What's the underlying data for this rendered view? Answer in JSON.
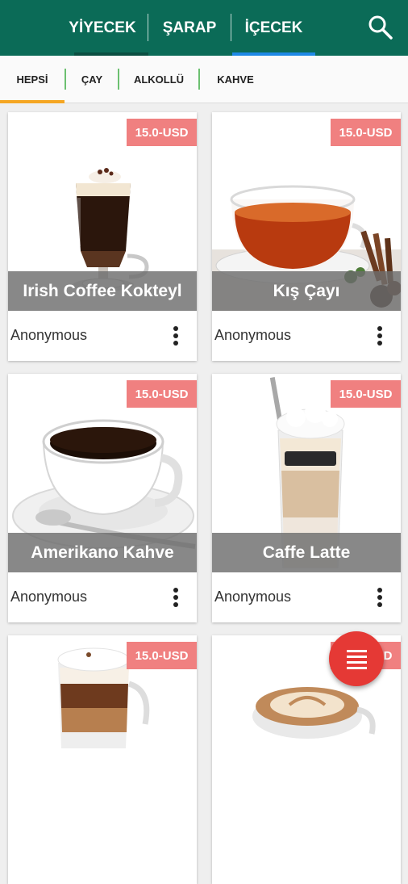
{
  "tabs": {
    "food": "YİYECEK",
    "wine": "ŞARAP",
    "drinks": "İÇECEK"
  },
  "filters": {
    "all": "HEPSİ",
    "tea": "ÇAY",
    "alcoholic": "ALKOLLÜ",
    "coffee": "KAHVE"
  },
  "colors": {
    "topbar": "#0b6b57",
    "active_tab_underline": "#1e88e5",
    "filter_underline": "#f5a623",
    "filter_separator": "#6cc070",
    "price_badge": "#f08080",
    "fab": "#e53935"
  },
  "icons": {
    "search": "search-icon",
    "more": "more-vert-icon",
    "fab": "menu-icon"
  },
  "cards": [
    {
      "price": "15.0-USD",
      "title": "Irish Coffee Kokteyl",
      "author": "Anonymous"
    },
    {
      "price": "15.0-USD",
      "title": "Kış Çayı",
      "author": "Anonymous"
    },
    {
      "price": "15.0-USD",
      "title": "Amerikano Kahve",
      "author": "Anonymous"
    },
    {
      "price": "15.0-USD",
      "title": "Caffe Latte",
      "author": "Anonymous"
    },
    {
      "price": "15.0-USD"
    },
    {
      "price": "15.0-USD"
    }
  ]
}
